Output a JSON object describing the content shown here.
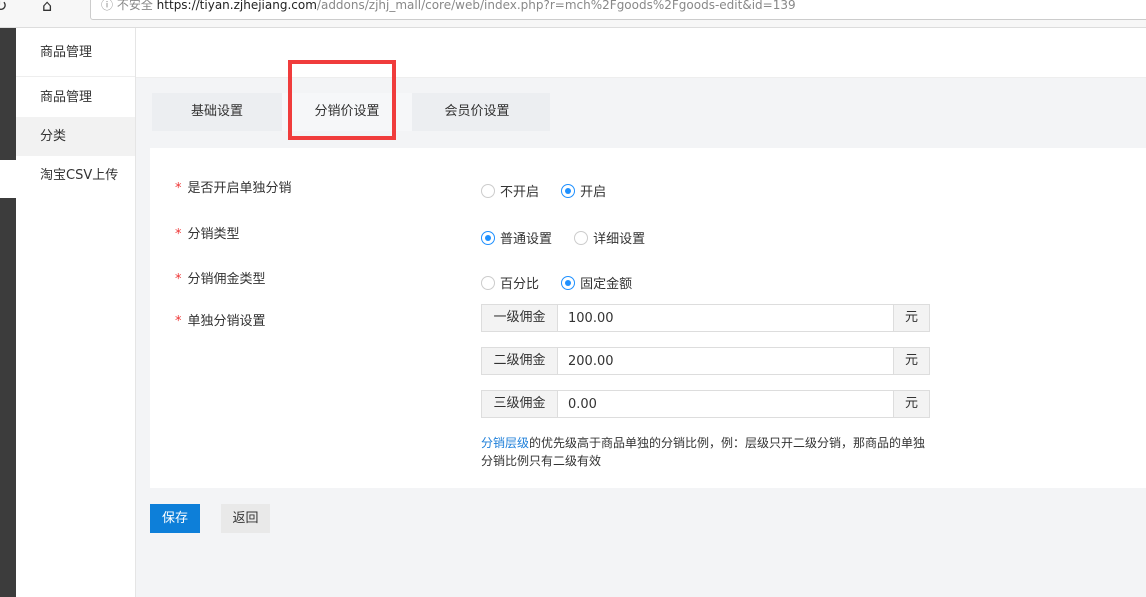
{
  "browser": {
    "security": "不安全",
    "url_host": "https://tiyan.zjhejiang.com",
    "url_path": "/addons/zjhj_mall/core/web/index.php?r=mch%2Fgoods%2Fgoods-edit&id=139"
  },
  "sidebar": {
    "title": "商品管理",
    "items": [
      {
        "label": "商品管理"
      },
      {
        "label": "分类"
      },
      {
        "label": "淘宝CSV上传"
      }
    ]
  },
  "tabs": [
    {
      "label": "基础设置"
    },
    {
      "label": "分销价设置"
    },
    {
      "label": "会员价设置"
    }
  ],
  "form": {
    "independent": {
      "label": "是否开启单独分销",
      "options": [
        "不开启",
        "开启"
      ],
      "selected": "开启"
    },
    "type": {
      "label": "分销类型",
      "options": [
        "普通设置",
        "详细设置"
      ],
      "selected": "普通设置"
    },
    "commission_type": {
      "label": "分销佣金类型",
      "options": [
        "百分比",
        "固定金额"
      ],
      "selected": "固定金额"
    },
    "settings": {
      "label": "单独分销设置",
      "levels": [
        {
          "name": "一级佣金",
          "value": "100.00",
          "unit": "元"
        },
        {
          "name": "二级佣金",
          "value": "200.00",
          "unit": "元"
        },
        {
          "name": "三级佣金",
          "value": "0.00",
          "unit": "元"
        }
      ]
    },
    "hint_link": "分销层级",
    "hint": "的优先级高于商品单独的分销比例，例：层级只开二级分销，那商品的单独分销比例只有二级有效"
  },
  "buttons": {
    "save": "保存",
    "back": "返回"
  },
  "colors": {
    "primary": "#0d7fd9",
    "highlight": "#f03c3c"
  }
}
